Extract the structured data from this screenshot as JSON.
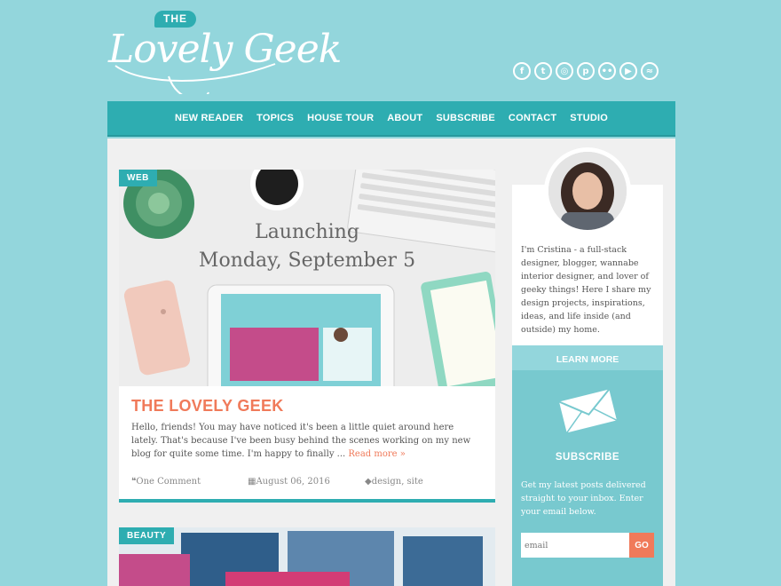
{
  "logo": {
    "the": "THE",
    "name": "Lovely Geek"
  },
  "social": [
    "f",
    "t",
    "◎",
    "p",
    "••",
    "▶",
    "≈"
  ],
  "nav": [
    "NEW READER",
    "TOPICS",
    "HOUSE TOUR",
    "ABOUT",
    "SUBSCRIBE",
    "CONTACT",
    "STUDIO"
  ],
  "post": {
    "category": "WEB",
    "hero_line1": "Launching",
    "hero_line2": "Monday, September 5",
    "title": "THE LOVELY GEEK",
    "excerpt": "Hello, friends! You may have noticed it's been a little quiet around here lately. That's because I've been busy behind the scenes working on my new blog for quite some time. I'm happy to finally ...",
    "read_more": "Read more »",
    "comments": "One Comment",
    "date": "August 06, 2016",
    "tags": "design, site"
  },
  "post2": {
    "category": "BEAUTY"
  },
  "sidebar": {
    "about_text": "I'm Cristina - a full-stack designer, blogger, wannabe interior designer, and lover of geeky things! Here I share my design projects, inspirations, ideas, and life inside (and outside) my home.",
    "learn_more": "LEARN MORE",
    "subscribe_title": "SUBSCRIBE",
    "subscribe_text": "Get my latest posts delivered straight to your inbox. Enter your email below.",
    "email_placeholder": "email",
    "go": "GO"
  },
  "colors": {
    "background": "#93d6dc",
    "teal": "#2eadb1",
    "accent": "#f07a5a"
  }
}
